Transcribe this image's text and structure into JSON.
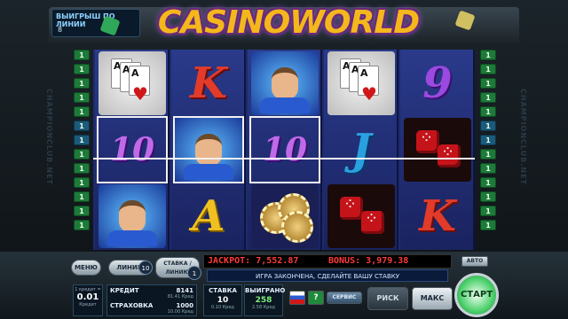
{
  "header": {
    "win_lines_label": "ВЫИГРЫШ ПО ЛИНИИ",
    "win_lines_value": "8",
    "logo": "CASINOWORLD"
  },
  "side": {
    "brand": "CHAMPIONCLUB.NET",
    "left_lines": [
      "1",
      "1",
      "1",
      "1",
      "1",
      "1",
      "1",
      "1",
      "1",
      "1",
      "1",
      "1",
      "1"
    ],
    "right_lines": [
      "1",
      "1",
      "1",
      "1",
      "1",
      "1",
      "1",
      "1",
      "1",
      "1",
      "1",
      "1",
      "1"
    ]
  },
  "reels": [
    [
      "cards",
      "10",
      "man"
    ],
    [
      "K",
      "man",
      "A"
    ],
    [
      "man",
      "10",
      "chips"
    ],
    [
      "cards",
      "J",
      "dice"
    ],
    [
      "9",
      "dice",
      "K"
    ]
  ],
  "controls": {
    "menu_label": "МЕНЮ",
    "lines_label": "ЛИНИИ",
    "lines_value": "10",
    "bet_per_line_label": "СТАВКА / ЛИНИЮ",
    "bet_per_line_value": "1",
    "jackpot_label": "JACKPOT:",
    "jackpot_value": "7,552.87",
    "bonus_label": "BONUS:",
    "bonus_value": "3,979.38",
    "auto_label": "АВТО",
    "message": "ИГРА ЗАКОНЧЕНА, СДЕЛАЙТЕ ВАШУ СТАВКУ",
    "denom_label": "1 кредит =",
    "denom_value": "0.01",
    "denom_currency": "Кредит",
    "credit_label": "КРЕДИТ",
    "credit_value": "8141",
    "credit_sub": "81.41 Кред",
    "insurance_label": "СТРАХОВКА",
    "insurance_value": "1000",
    "insurance_sub": "10.00 Кред",
    "bet_label": "СТАВКА",
    "bet_value": "10",
    "bet_sub": "0.10 Кред",
    "won_label": "ВЫИГРАНО",
    "won_value": "258",
    "won_sub": "2.58 Кред",
    "service_label": "СЕРВИС",
    "risk_label": "РИСК",
    "max_label": "МАКС",
    "start_label": "СТАРТ",
    "help_label": "?"
  }
}
